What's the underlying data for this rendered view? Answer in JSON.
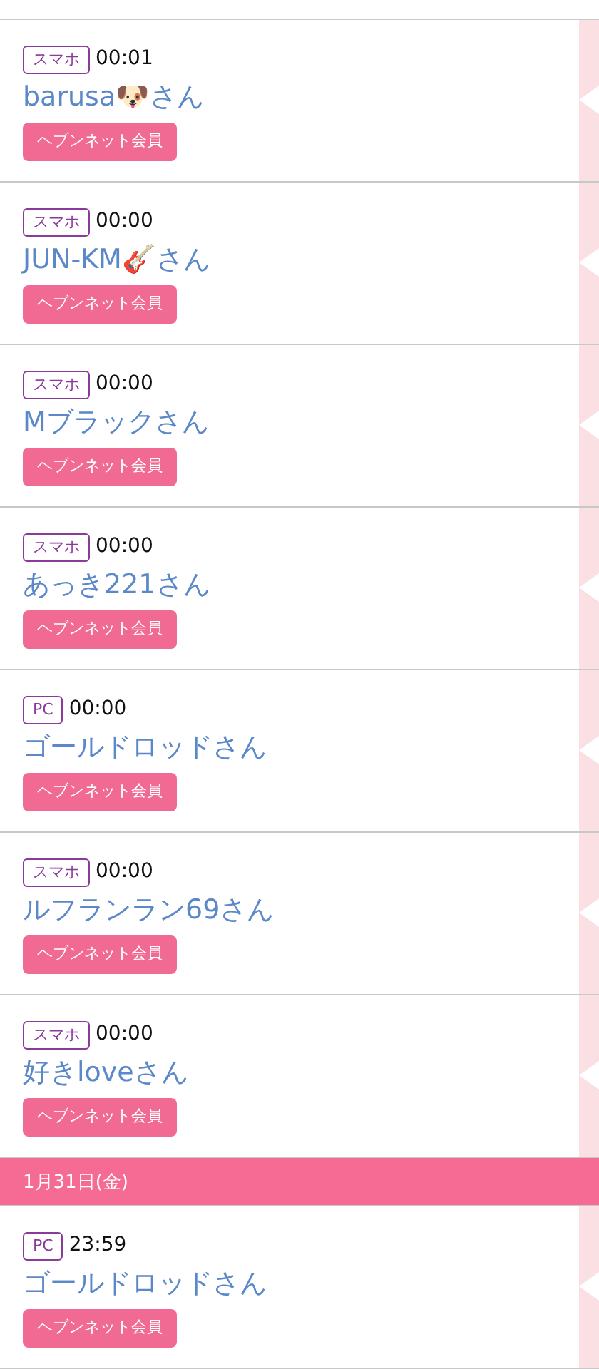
{
  "feed": [
    {
      "kind": "entry",
      "device": "スマホ",
      "time": "00:01",
      "name": "barusa🐶さん",
      "badge": "ヘブンネット会員"
    },
    {
      "kind": "entry",
      "device": "スマホ",
      "time": "00:00",
      "name": "JUN-KM🎸さん",
      "badge": "ヘブンネット会員"
    },
    {
      "kind": "entry",
      "device": "スマホ",
      "time": "00:00",
      "name": "Mブラックさん",
      "badge": "ヘブンネット会員"
    },
    {
      "kind": "entry",
      "device": "スマホ",
      "time": "00:00",
      "name": "あっき221さん",
      "badge": "ヘブンネット会員"
    },
    {
      "kind": "entry",
      "device": "PC",
      "time": "00:00",
      "name": "ゴールドロッドさん",
      "badge": "ヘブンネット会員"
    },
    {
      "kind": "entry",
      "device": "スマホ",
      "time": "00:00",
      "name": "ルフランラン69さん",
      "badge": "ヘブンネット会員"
    },
    {
      "kind": "entry",
      "device": "スマホ",
      "time": "00:00",
      "name": "好きloveさん",
      "badge": "ヘブンネット会員"
    },
    {
      "kind": "date",
      "label": "1月31日(金)"
    },
    {
      "kind": "entry",
      "device": "PC",
      "time": "23:59",
      "name": "ゴールドロッドさん",
      "badge": "ヘブンネット会員"
    }
  ]
}
